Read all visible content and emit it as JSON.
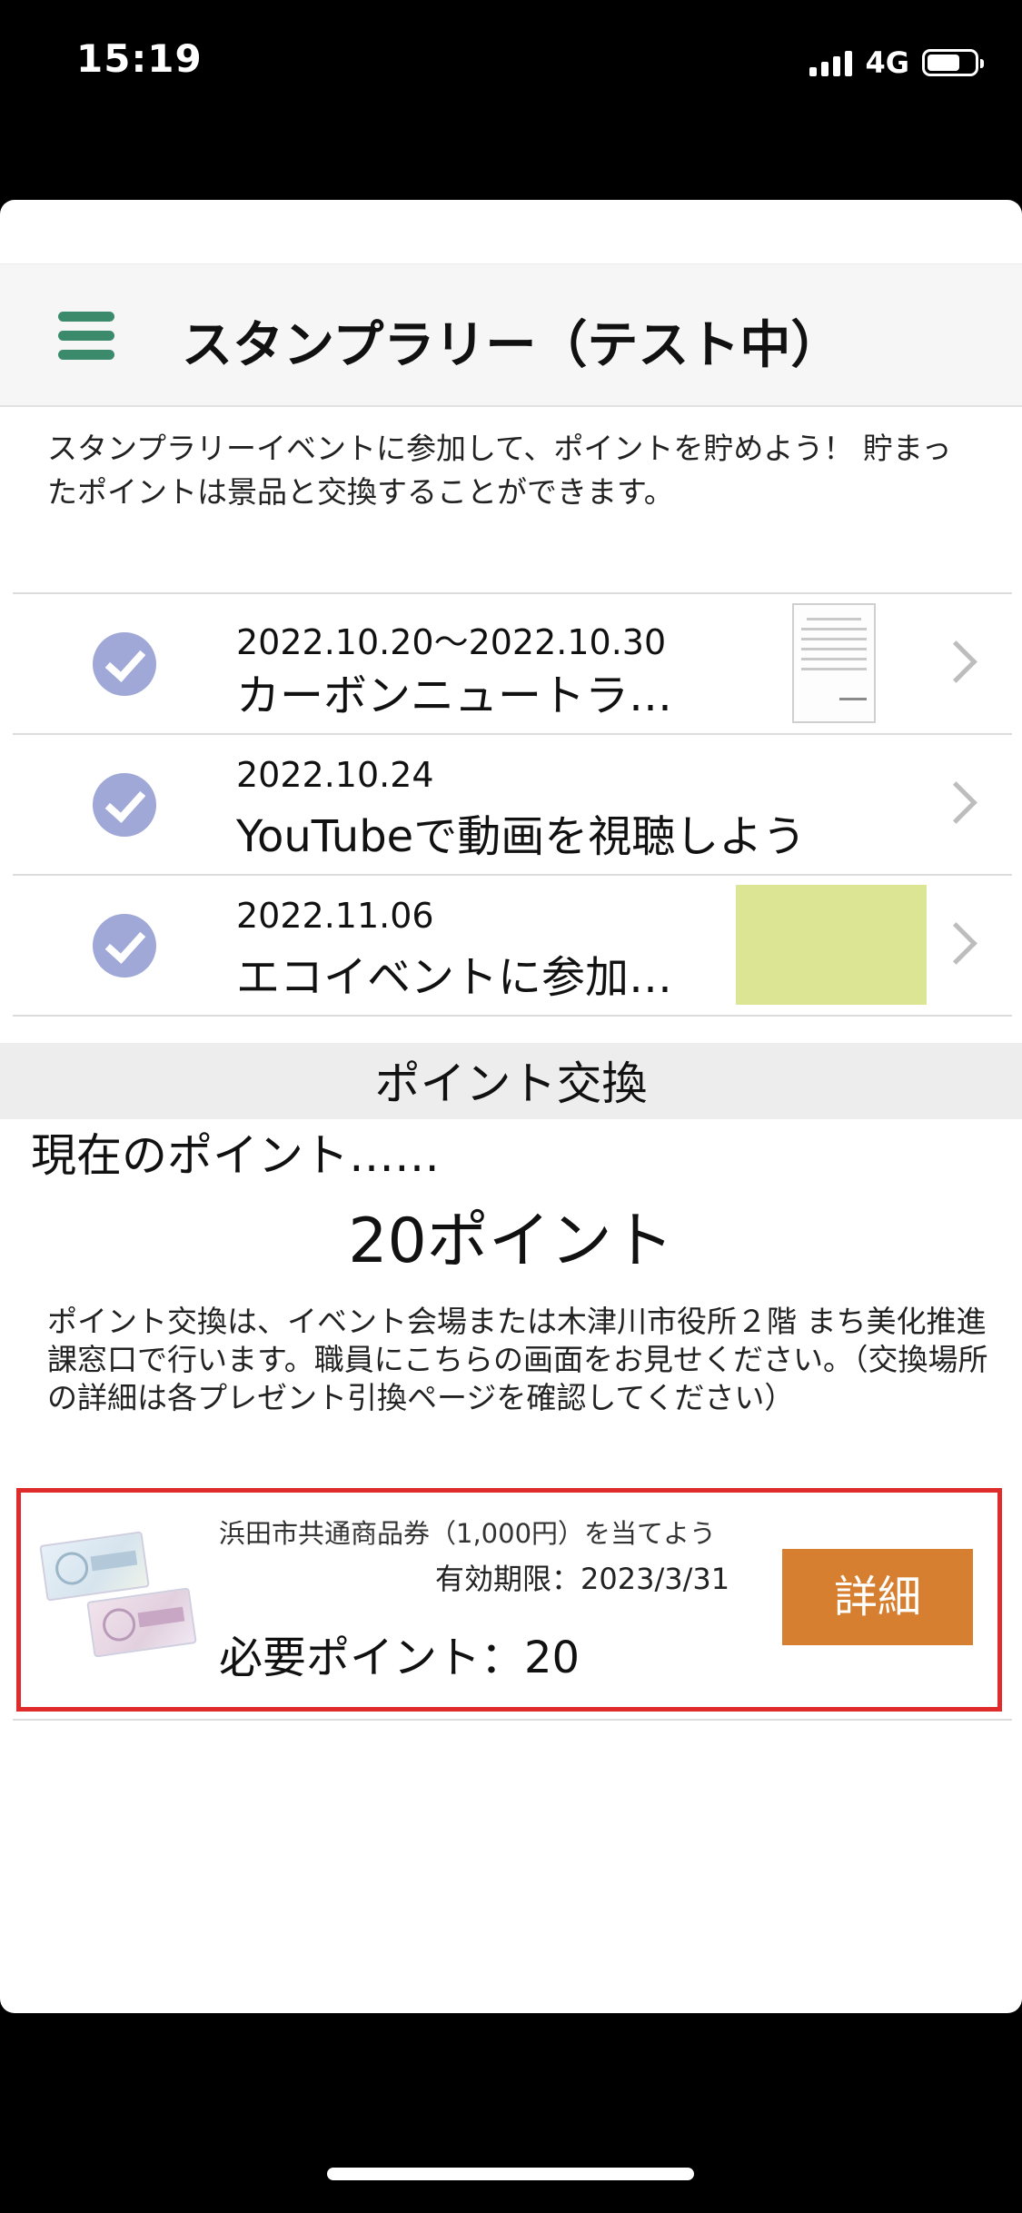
{
  "status_bar": {
    "time": "15:19",
    "network": "4G"
  },
  "nav": {
    "title": "スタンプラリー（テスト中）",
    "menu_icon": "hamburger-icon",
    "accent_color": "#3c8a6c"
  },
  "intro": {
    "text": "スタンプラリーイベントに参加して、ポイントを貯めよう！ 貯まったポイントは景品と交換することができます。"
  },
  "events": [
    {
      "date": "2022.10.20～2022.10.30",
      "title": "カーボンニュートラ…",
      "completed": true,
      "thumbnail": "document"
    },
    {
      "date": "2022.10.24",
      "title": "YouTubeで動画を視聴しよう",
      "completed": true,
      "thumbnail": "none"
    },
    {
      "date": "2022.11.06",
      "title": "エコイベントに参加…",
      "completed": true,
      "thumbnail": "green-image"
    }
  ],
  "exchange": {
    "header": "ポイント交換",
    "current_label": "現在のポイント……",
    "points_value": "20ポイント",
    "note": "ポイント交換は、イベント会場または木津川市役所２階 まち美化推進課窓口で行います。職員にこちらの画面をお見せください。（交換場所の詳細は各プレゼント引換ページを確認してください）"
  },
  "prize": {
    "title": "浜田市共通商品券（1,000円）を当てよう",
    "expiry": "有効期限：2023/3/31",
    "required_points": "必要ポイント：20",
    "detail_label": "詳細",
    "button_color": "#d77f30",
    "highlight_color": "#e02b2b"
  }
}
